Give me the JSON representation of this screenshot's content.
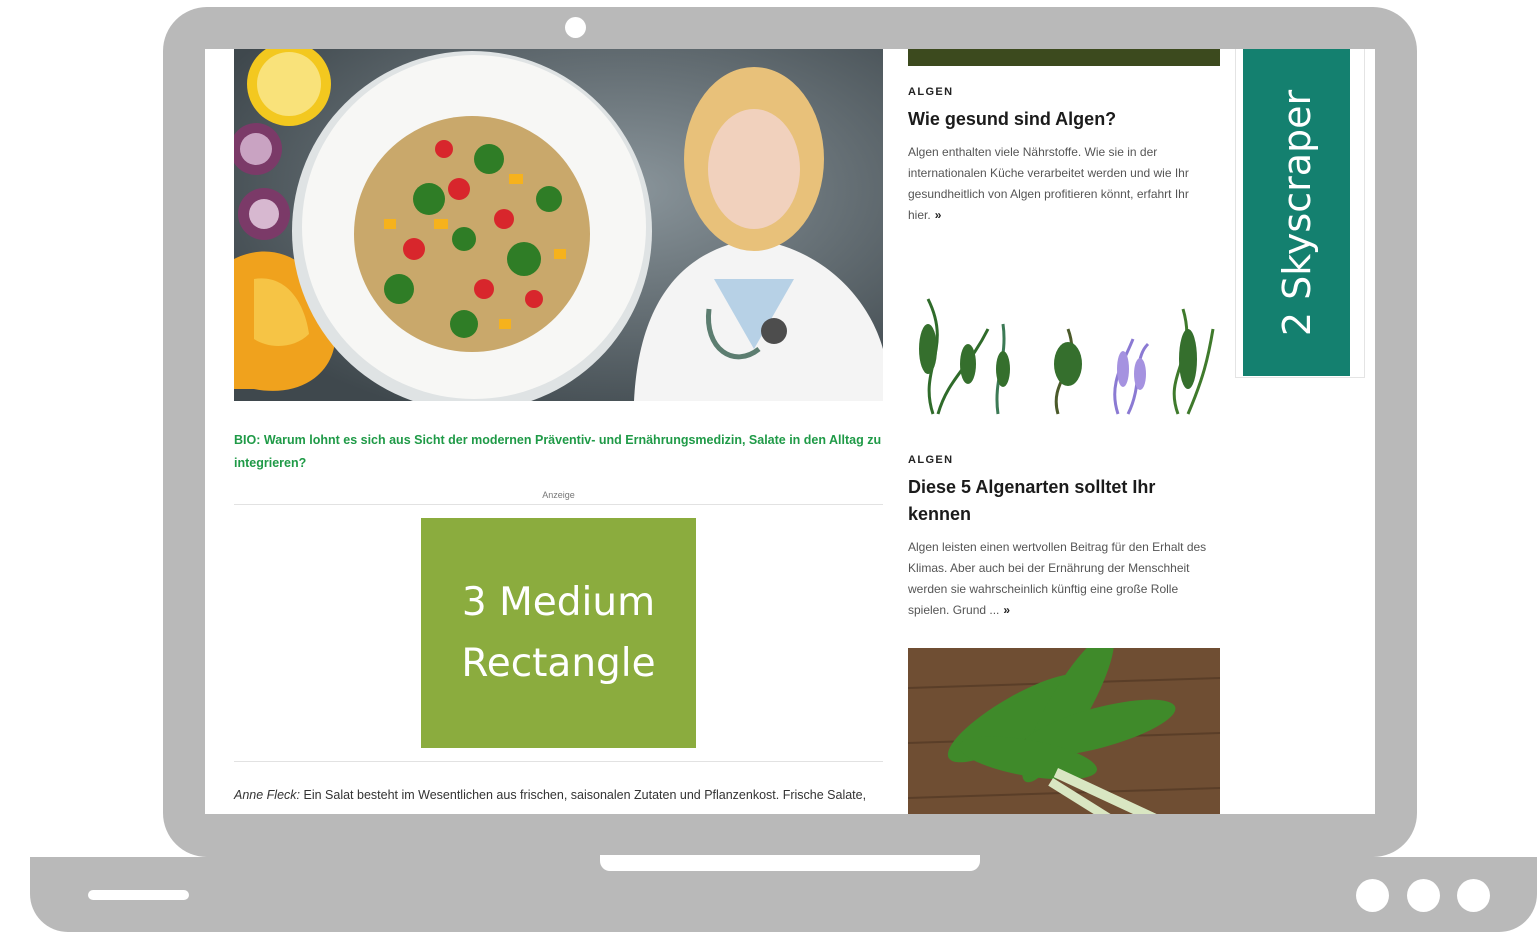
{
  "main": {
    "caption": "BIO: Warum lohnt es sich aus Sicht der modernen Präventiv- und Ernährungsmedizin, Salate in den Alltag zu integrieren?",
    "ad_label": "Anzeige",
    "ad_medium_rectangle": "3 Medium Rectangle",
    "body_author": "Anne Fleck:",
    "body_text": "Ein Salat besteht im Wesentlichen aus frischen, saisonalen Zutaten und Pflanzenkost. Frische Salate,"
  },
  "sidebar": {
    "cards": [
      {
        "kicker": "ALGEN",
        "title": "Wie gesund sind Algen?",
        "teaser": "Algen enthalten viele Nährstoffe. Wie sie in der internationalen Küche verarbeitet werden und wie Ihr gesundheitlich von Algen profitieren könnt, erfahrt Ihr hier.",
        "more": "»"
      },
      {
        "kicker": "ALGEN",
        "title": "Diese 5 Algenarten solltet Ihr kennen",
        "teaser": "Algen leisten einen wertvollen Beitrag für den Erhalt des Klimas. Aber auch bei der Ernährung der Menschheit werden sie wahrscheinlich künftig eine große Rolle spielen. Grund ...",
        "more": "»"
      }
    ]
  },
  "ads": {
    "skyscraper": "2 Skyscraper"
  },
  "icons": {
    "camera": "camera-dot",
    "more_arrow": "double-chevron-right"
  },
  "colors": {
    "laptop": "#b9b9b9",
    "caption_green": "#1f9a47",
    "medium_rectangle": "#8bac3e",
    "skyscraper": "#14806f"
  }
}
